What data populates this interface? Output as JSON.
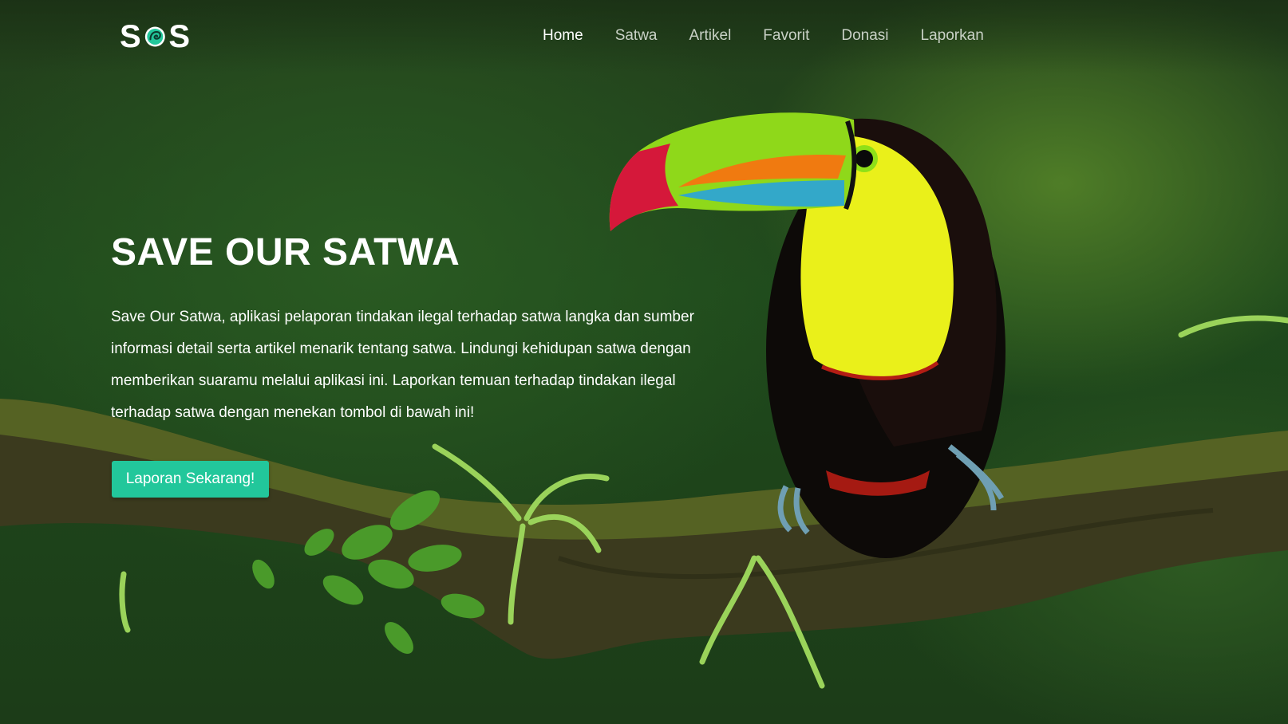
{
  "brand": {
    "logo_left": "S",
    "logo_right": "S",
    "logo_icon": "sea-turtle-shell-icon"
  },
  "nav": {
    "items": [
      {
        "label": "Home",
        "active": true
      },
      {
        "label": "Satwa",
        "active": false
      },
      {
        "label": "Artikel",
        "active": false
      },
      {
        "label": "Favorit",
        "active": false
      },
      {
        "label": "Donasi",
        "active": false
      },
      {
        "label": "Laporkan",
        "active": false
      }
    ]
  },
  "hero": {
    "title": "SAVE OUR SATWA",
    "description": "Save Our Satwa, aplikasi pelaporan tindakan ilegal terhadap satwa langka dan sumber informasi detail serta artikel menarik tentang satwa. Lindungi kehidupan satwa dengan memberikan suaramu melalui aplikasi ini. Laporkan temuan terhadap tindakan ilegal terhadap satwa dengan menekan tombol di bawah ini!",
    "cta_label": "Laporan Sekarang!",
    "image": "toucan-on-mossy-branch"
  },
  "colors": {
    "accent": "#22c79b",
    "text": "#ffffff",
    "nav_inactive": "#c9d1c6"
  }
}
